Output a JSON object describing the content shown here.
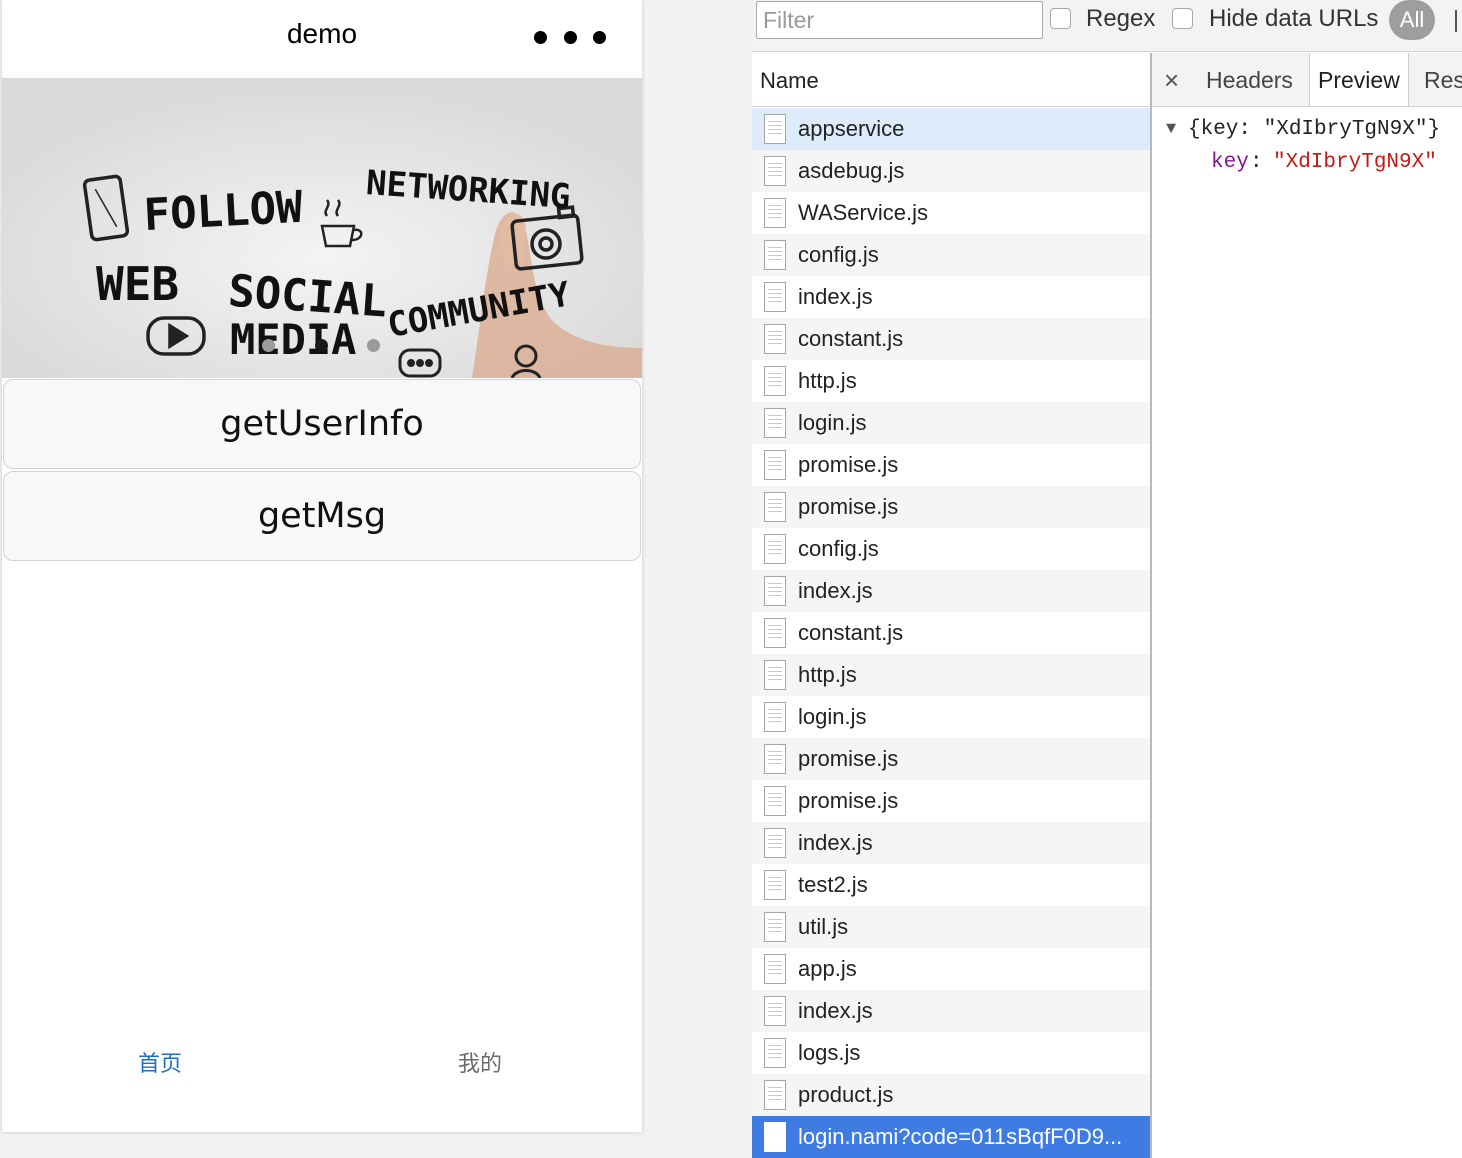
{
  "simulator": {
    "title": "demo",
    "buttons": {
      "user_info": "getUserInfo",
      "get_msg": "getMsg"
    },
    "banner": {
      "words": {
        "follow": "FOLLOW",
        "networking": "NETWORKING",
        "web": "WEB",
        "social": "SOCIAL",
        "media": "MEDIA",
        "community": "COMMUNITY"
      },
      "active_dot": 2,
      "dot_count": 3
    },
    "tabbar": {
      "home": "首页",
      "mine": "我的",
      "active_color": "#1f6fc5",
      "inactive_color": "#6a6a6a"
    }
  },
  "devtools": {
    "filter": {
      "placeholder": "Filter",
      "value": ""
    },
    "regex_label": "Regex",
    "hide_data_urls_label": "Hide data URLs",
    "all_label": "All",
    "name_header": "Name",
    "requests": [
      {
        "name": "appservice",
        "state": "hover"
      },
      {
        "name": "asdebug.js"
      },
      {
        "name": "WAService.js"
      },
      {
        "name": "config.js"
      },
      {
        "name": "index.js"
      },
      {
        "name": "constant.js"
      },
      {
        "name": "http.js"
      },
      {
        "name": "login.js"
      },
      {
        "name": "promise.js"
      },
      {
        "name": "promise.js"
      },
      {
        "name": "config.js"
      },
      {
        "name": "index.js"
      },
      {
        "name": "constant.js"
      },
      {
        "name": "http.js"
      },
      {
        "name": "login.js"
      },
      {
        "name": "promise.js"
      },
      {
        "name": "promise.js"
      },
      {
        "name": "index.js"
      },
      {
        "name": "test2.js"
      },
      {
        "name": "util.js"
      },
      {
        "name": "app.js"
      },
      {
        "name": "index.js"
      },
      {
        "name": "logs.js"
      },
      {
        "name": "product.js"
      },
      {
        "name": "login.nami?code=011sBqfF0D9...",
        "state": "selected"
      }
    ],
    "detail_tabs": {
      "close": "×",
      "headers": "Headers",
      "preview": "Preview",
      "response": "Res"
    },
    "preview": {
      "toggle": "▼",
      "summary": "{key: \"XdIbryTgN9X\"}",
      "key": "key",
      "colon": ":",
      "value": "\"XdIbryTgN9X\""
    },
    "colors": {
      "selected_row": "#3e7be3",
      "hover_row": "#deebfb",
      "json_key": "#881391",
      "json_string": "#c41a16"
    }
  }
}
